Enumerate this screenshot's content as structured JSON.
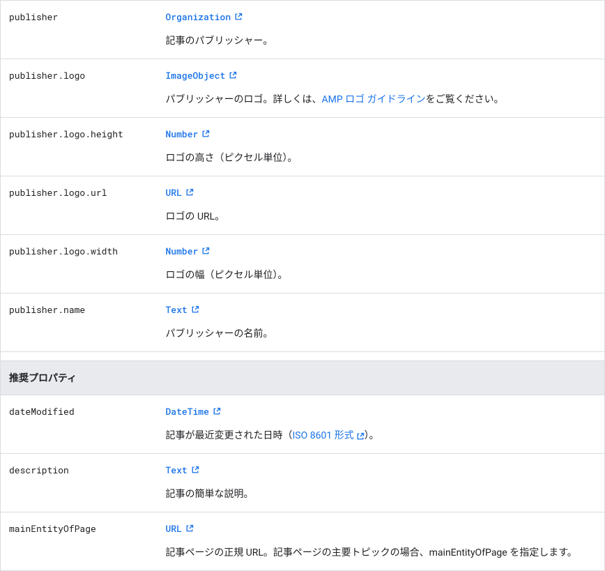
{
  "section1": {
    "rows": [
      {
        "name": "publisher",
        "type": "Organization",
        "description_parts": [
          {
            "text": "記事のパブリッシャー。"
          }
        ]
      },
      {
        "name": "publisher.logo",
        "type": "ImageObject",
        "description_parts": [
          {
            "text": "パブリッシャーのロゴ。詳しくは、"
          },
          {
            "link": "AMP ロゴ ガイドライン"
          },
          {
            "text": "をご覧ください。"
          }
        ]
      },
      {
        "name": "publisher.logo.height",
        "type": "Number",
        "description_parts": [
          {
            "text": "ロゴの高さ（ピクセル単位）。"
          }
        ]
      },
      {
        "name": "publisher.logo.url",
        "type": "URL",
        "description_parts": [
          {
            "text": "ロゴの URL。"
          }
        ]
      },
      {
        "name": "publisher.logo.width",
        "type": "Number",
        "description_parts": [
          {
            "text": "ロゴの幅（ピクセル単位）。"
          }
        ]
      },
      {
        "name": "publisher.name",
        "type": "Text",
        "description_parts": [
          {
            "text": "パブリッシャーの名前。"
          }
        ]
      }
    ]
  },
  "section2_header": "推奨プロパティ",
  "section2": {
    "rows": [
      {
        "name": "dateModified",
        "type": "DateTime",
        "description_parts": [
          {
            "text": "記事が最近変更された日時（"
          },
          {
            "link_ext": "ISO 8601 形式"
          },
          {
            "text": "）。"
          }
        ]
      },
      {
        "name": "description",
        "type": "Text",
        "description_parts": [
          {
            "text": "記事の簡単な説明。"
          }
        ]
      },
      {
        "name": "mainEntityOfPage",
        "type": "URL",
        "description_parts": [
          {
            "text": "記事ページの正規 URL。記事ページの主要トピックの場合、mainEntityOfPage を指定します。"
          }
        ]
      }
    ]
  }
}
